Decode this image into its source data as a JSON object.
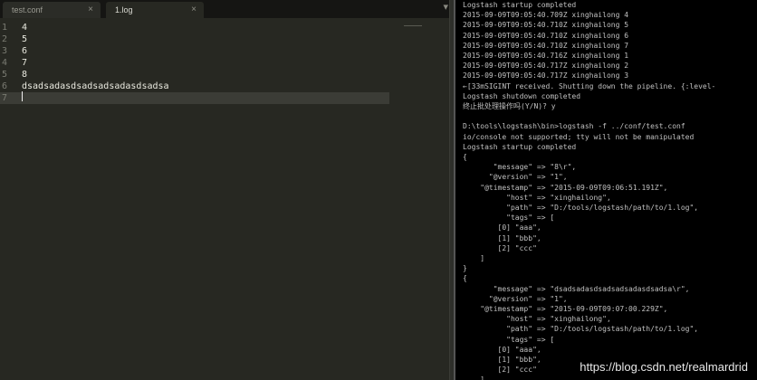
{
  "editor": {
    "tabs": [
      {
        "label": "test.conf",
        "close": "×"
      },
      {
        "label": "1.log",
        "close": "×"
      }
    ],
    "tabbar_arrow": "▾",
    "lines": [
      {
        "num": "1",
        "text": "4"
      },
      {
        "num": "2",
        "text": "5"
      },
      {
        "num": "3",
        "text": "6"
      },
      {
        "num": "4",
        "text": "7"
      },
      {
        "num": "5",
        "text": "8"
      },
      {
        "num": "6",
        "text": "dsadsadasdsadsadsadasdsadsa"
      },
      {
        "num": "7",
        "text": ""
      }
    ],
    "current_line": 7
  },
  "console": {
    "lines": [
      "Logstash startup completed",
      "2015-09-09T09:05:40.709Z xinghailong 4",
      "2015-09-09T09:05:40.710Z xinghailong 5",
      "2015-09-09T09:05:40.710Z xinghailong 6",
      "2015-09-09T09:05:40.710Z xinghailong 7",
      "2015-09-09T09:05:40.716Z xinghailong 1",
      "2015-09-09T09:05:40.717Z xinghailong 2",
      "2015-09-09T09:05:40.717Z xinghailong 3",
      "←[33mSIGINT received. Shutting down the pipeline. {:level-",
      "Logstash shutdown completed",
      "终止批处理操作吗(Y/N)? y",
      "",
      "D:\\tools\\logstash\\bin>logstash -f ../conf/test.conf",
      "io/console not supported; tty will not be manipulated",
      "Logstash startup completed",
      "{",
      "       \"message\" => \"8\\r\",",
      "      \"@version\" => \"1\",",
      "    \"@timestamp\" => \"2015-09-09T09:06:51.191Z\",",
      "          \"host\" => \"xinghailong\",",
      "          \"path\" => \"D:/tools/logstash/path/to/1.log\",",
      "          \"tags\" => [",
      "        [0] \"aaa\",",
      "        [1] \"bbb\",",
      "        [2] \"ccc\"",
      "    ]",
      "}",
      "{",
      "       \"message\" => \"dsadsadasdsadsadsadasdsadsa\\r\",",
      "      \"@version\" => \"1\",",
      "    \"@timestamp\" => \"2015-09-09T09:07:00.229Z\",",
      "          \"host\" => \"xinghailong\",",
      "          \"path\" => \"D:/tools/logstash/path/to/1.log\",",
      "          \"tags\" => [",
      "        [0] \"aaa\",",
      "        [1] \"bbb\",",
      "        [2] \"ccc\"",
      "    ]"
    ]
  },
  "watermark": "https://blog.csdn.net/realmardrid"
}
